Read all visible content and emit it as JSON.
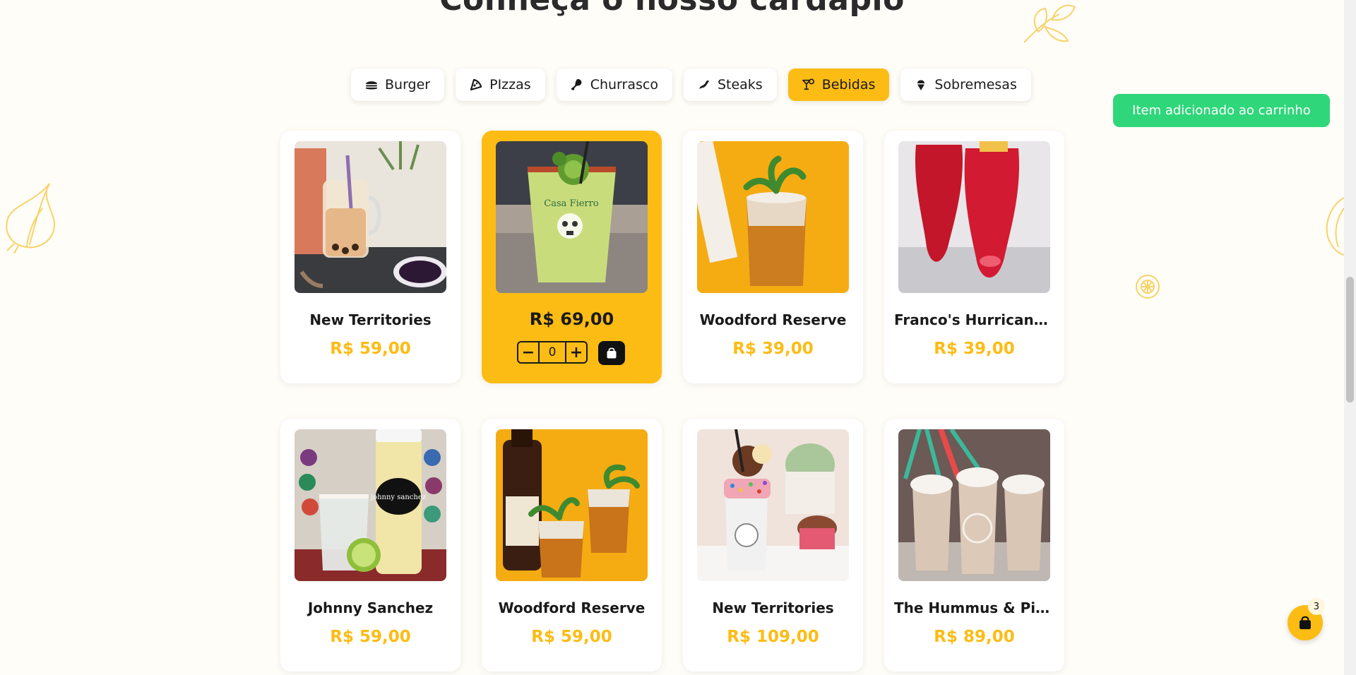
{
  "section": {
    "title": "Conheça o nosso cardápio"
  },
  "tabs": [
    {
      "label": "Burger",
      "icon": "burger-icon",
      "active": false
    },
    {
      "label": "PIzzas",
      "icon": "pizza-icon",
      "active": false
    },
    {
      "label": "Churrasco",
      "icon": "drumstick-icon",
      "active": false
    },
    {
      "label": "Steaks",
      "icon": "steak-icon",
      "active": false
    },
    {
      "label": "Bebidas",
      "icon": "cocktail-icon",
      "active": true
    },
    {
      "label": "Sobremesas",
      "icon": "ice-cream-icon",
      "active": false
    }
  ],
  "toast": {
    "message": "Item adicionado ao carrinho"
  },
  "products": [
    {
      "name": "New Territories",
      "price": "R$ 59,00",
      "icon": "bubble-tea-photo"
    },
    {
      "name": "",
      "price": "R$ 69,00",
      "icon": "margarita-photo",
      "hovered": true,
      "quantity": "0"
    },
    {
      "name": "Woodford Reserve",
      "price": "R$ 39,00",
      "icon": "iced-tea-photo"
    },
    {
      "name": "Franco's Hurricane...",
      "price": "R$ 39,00",
      "icon": "red-cocktail-photo"
    },
    {
      "name": "Johnny Sanchez",
      "price": "R$ 59,00",
      "icon": "lime-juice-photo"
    },
    {
      "name": "Woodford Reserve",
      "price": "R$ 59,00",
      "icon": "mint-julep-photo"
    },
    {
      "name": "New Territories",
      "price": "R$ 109,00",
      "icon": "freakshake-photo"
    },
    {
      "name": "The Hummus & Pit...",
      "price": "R$ 89,00",
      "icon": "milkshake-photo"
    }
  ],
  "cart": {
    "count": "3"
  },
  "colors": {
    "accent": "#fcbc14",
    "success": "#2fd67a",
    "background": "#fffdf7"
  }
}
